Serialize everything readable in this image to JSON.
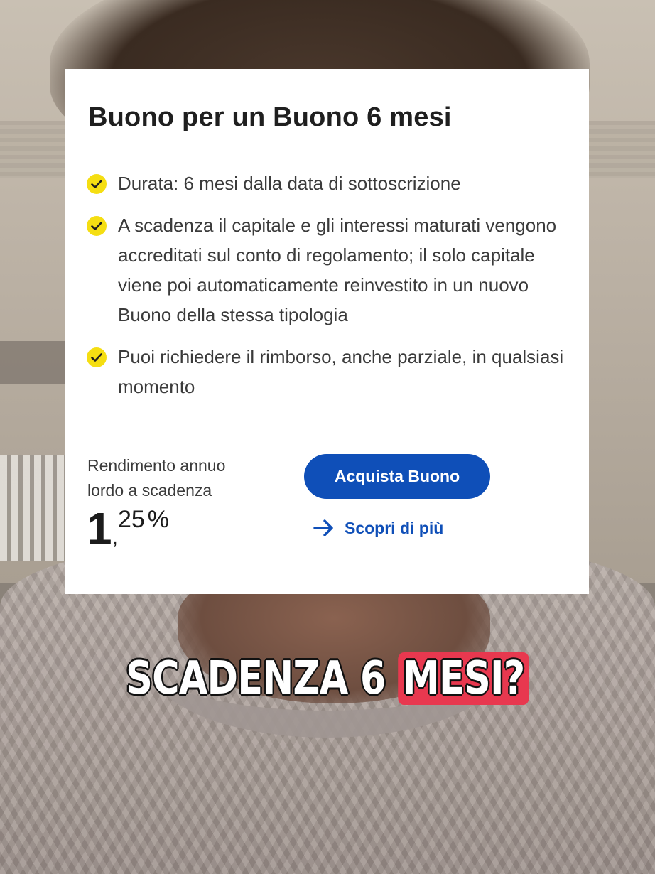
{
  "card": {
    "title": "Buono per un Buono 6 mesi",
    "bullets": [
      "Durata: 6 mesi dalla data di sottoscrizione",
      "A scadenza il capitale e gli interessi maturati vengono accreditati sul conto di regolamento; il solo capitale viene poi automaticamente reinvestito in un nuovo Buono della stessa tipologia",
      "Puoi richiedere il rimborso, anche parziale, in qualsiasi momento"
    ],
    "rendimento_label": "Rendimento annuo lordo a scadenza",
    "rate_int": "1",
    "rate_sep": ",",
    "rate_dec": "25",
    "rate_pct": "%",
    "buy_button": "Acquista Buono",
    "more_link": "Scopri di più"
  },
  "caption": {
    "plain": "SCADENZA 6 ",
    "highlight": "MESI?"
  },
  "colors": {
    "accent_blue": "#0f4fb8",
    "check_yellow": "#f5de12",
    "caption_highlight": "#e8384f"
  },
  "icons": [
    "check-icon",
    "arrow-right-icon"
  ]
}
